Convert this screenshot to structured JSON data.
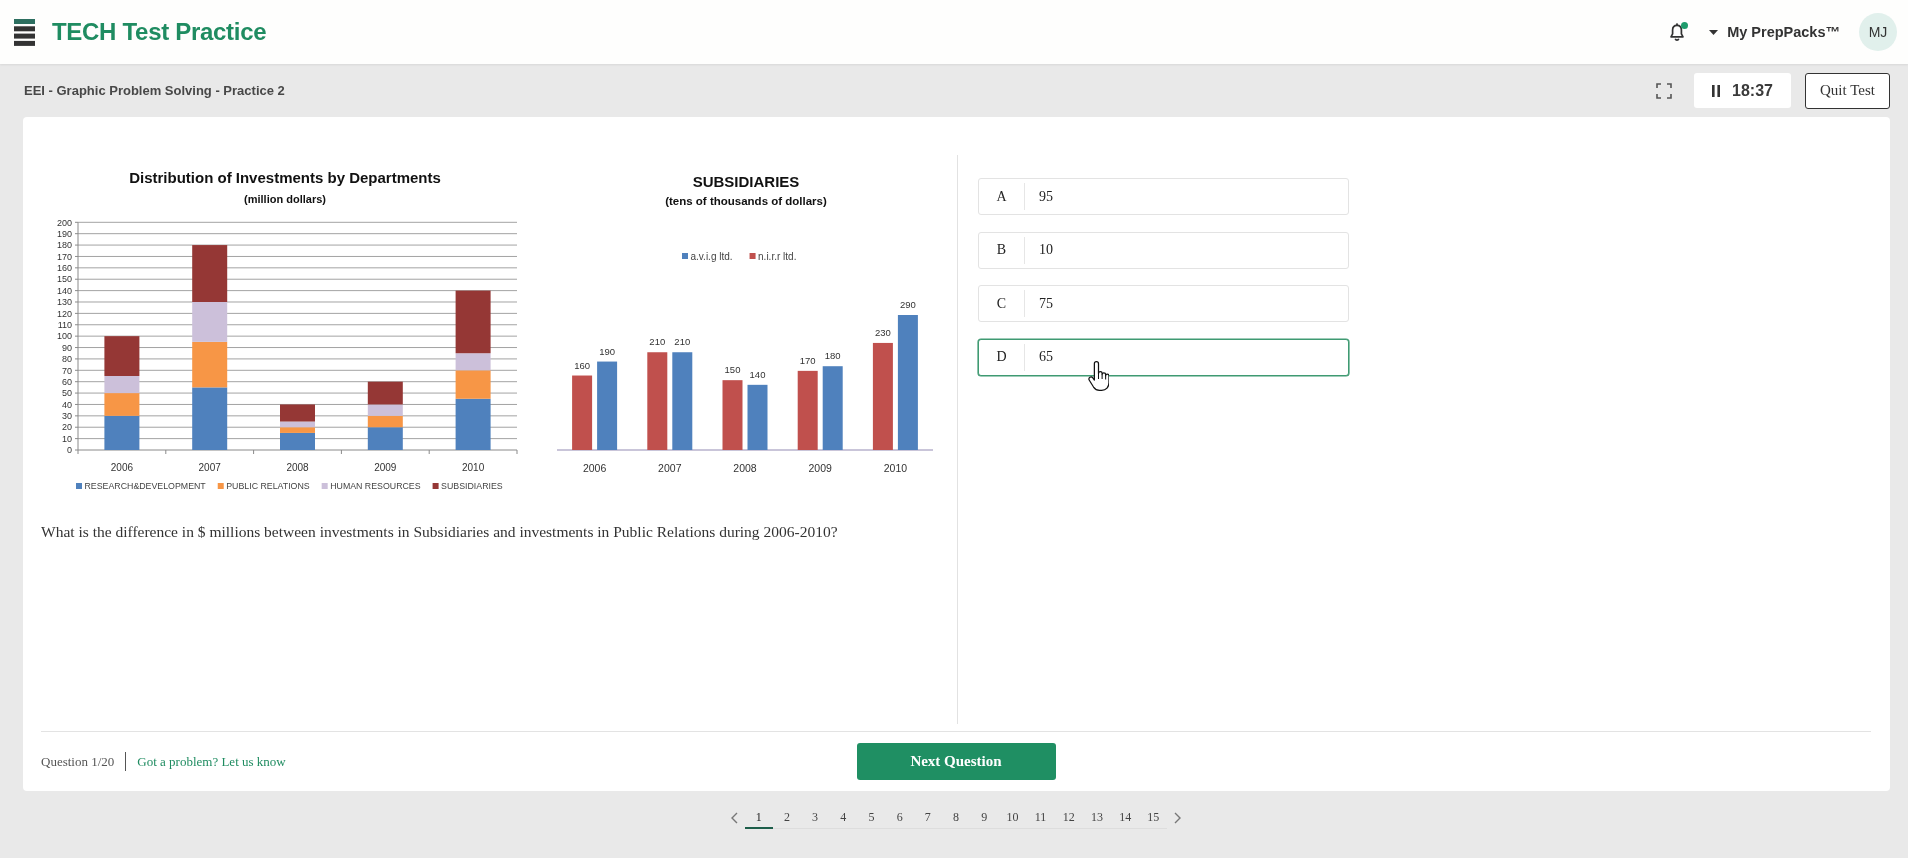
{
  "header": {
    "brand": "TECH Test Practice",
    "notifications": {
      "unread": true
    },
    "account_menu": "My PrepPacks™",
    "avatar": "MJ"
  },
  "test_bar": {
    "title": "EEI - Graphic Problem Solving - Practice 2",
    "timer": "18:37",
    "quit_button": "Quit Test"
  },
  "question": {
    "charts": [
      {
        "subtitle": "(million dollars)",
        "chart_data": {
          "type": "bar",
          "title": "Distribution of Investments by Departments",
          "categories": [
            "2006",
            "2007",
            "2008",
            "2009",
            "2010"
          ],
          "series": [
            {
              "name": "RESEARCH&DEVELOPMENT",
              "color": "#4f81bd",
              "values": [
                30,
                55,
                15,
                20,
                45
              ]
            },
            {
              "name": "PUBLIC RELATIONS",
              "color": "#f79646",
              "values": [
                20,
                40,
                5,
                10,
                25
              ]
            },
            {
              "name": "HUMAN RESOURCES",
              "color": "#ccc0da",
              "values": [
                15,
                35,
                5,
                10,
                15
              ]
            },
            {
              "name": "SUBSIDIARIES",
              "color": "#953735",
              "values": [
                35,
                50,
                15,
                20,
                55
              ]
            }
          ],
          "ylim": [
            0,
            200
          ],
          "yticks": [
            0,
            10,
            20,
            30,
            40,
            50,
            60,
            70,
            80,
            90,
            100,
            110,
            120,
            130,
            140,
            150,
            160,
            170,
            180,
            190,
            200
          ],
          "grid": true,
          "legend": "bottom",
          "stacked": true
        }
      },
      {
        "subtitle": "(tens of thousands of dollars)",
        "chart_data": {
          "type": "bar",
          "title": "SUBSIDIARIES",
          "categories": [
            "2006",
            "2007",
            "2008",
            "2009",
            "2010"
          ],
          "series": [
            {
              "name": "a.v.i.g ltd.",
              "color": "#4f81bd",
              "values": [
                190,
                210,
                140,
                180,
                290
              ]
            },
            {
              "name": "n.i.r.r ltd.",
              "color": "#c0504d",
              "values": [
                160,
                210,
                150,
                170,
                230
              ]
            }
          ],
          "legend": "top",
          "stacked": false,
          "data_labels": true
        }
      }
    ],
    "text": "What is the difference in $ millions between investments in Subsidiaries and investments in Public Relations during 2006-2010?"
  },
  "options": [
    {
      "letter": "A",
      "text": "95",
      "selected": false
    },
    {
      "letter": "B",
      "text": "10",
      "selected": false
    },
    {
      "letter": "C",
      "text": "75",
      "selected": false
    },
    {
      "letter": "D",
      "text": "65",
      "selected": true
    }
  ],
  "footer": {
    "progress": "Question 1/20",
    "report_link": "Got a problem? Let us know",
    "next_button": "Next Question"
  },
  "pagination": {
    "pages": [
      {
        "label": "1",
        "selected": true
      },
      {
        "label": "2",
        "selected": false
      },
      {
        "label": "3",
        "selected": false
      },
      {
        "label": "4",
        "selected": false
      },
      {
        "label": "5",
        "selected": false
      },
      {
        "label": "6",
        "selected": false
      },
      {
        "label": "7",
        "selected": false
      },
      {
        "label": "8",
        "selected": false
      },
      {
        "label": "9",
        "selected": false
      },
      {
        "label": "10",
        "selected": false
      },
      {
        "label": "11",
        "selected": false
      },
      {
        "label": "12",
        "selected": false
      },
      {
        "label": "13",
        "selected": false
      },
      {
        "label": "14",
        "selected": false
      },
      {
        "label": "15",
        "selected": false
      }
    ]
  }
}
